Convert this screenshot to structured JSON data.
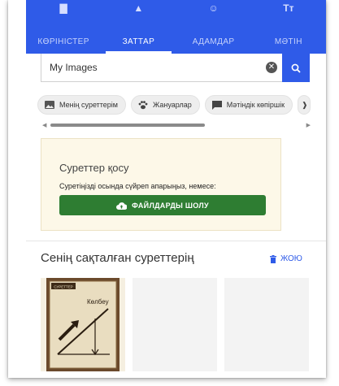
{
  "tabs": [
    {
      "label": "КӨРІНІСТЕР",
      "icon": "image-icon"
    },
    {
      "label": "ЗАТТАР",
      "icon": "shapes-icon"
    },
    {
      "label": "АДАМДАР",
      "icon": "smiley-icon"
    },
    {
      "label": "МӘТІН",
      "icon": "text-icon"
    }
  ],
  "active_tab": 1,
  "search": {
    "value": "My Images",
    "placeholder": ""
  },
  "chips": [
    {
      "label": "Менің суреттерім",
      "icon": "image-icon"
    },
    {
      "label": "Жануарлар",
      "icon": "paw-icon"
    },
    {
      "label": "Мәтіндік көпіршік",
      "icon": "speech-bubble-icon"
    }
  ],
  "upload": {
    "title": "Суреттер қосу",
    "hint": "Суретіңізді осында сүйреп апарыңыз, немесе:",
    "button_label": "ФАЙЛДАРДЫ ШОЛУ"
  },
  "saved": {
    "title": "Сенің сақталған суреттерің",
    "delete_label": "ЖОЮ",
    "first_image": {
      "header_text": "СУРЕТТЕР",
      "caption": "Көлбеу"
    }
  },
  "colors": {
    "primary": "#2f5be8",
    "upload_button": "#2e7d32",
    "upload_panel": "#fdf8e8"
  }
}
